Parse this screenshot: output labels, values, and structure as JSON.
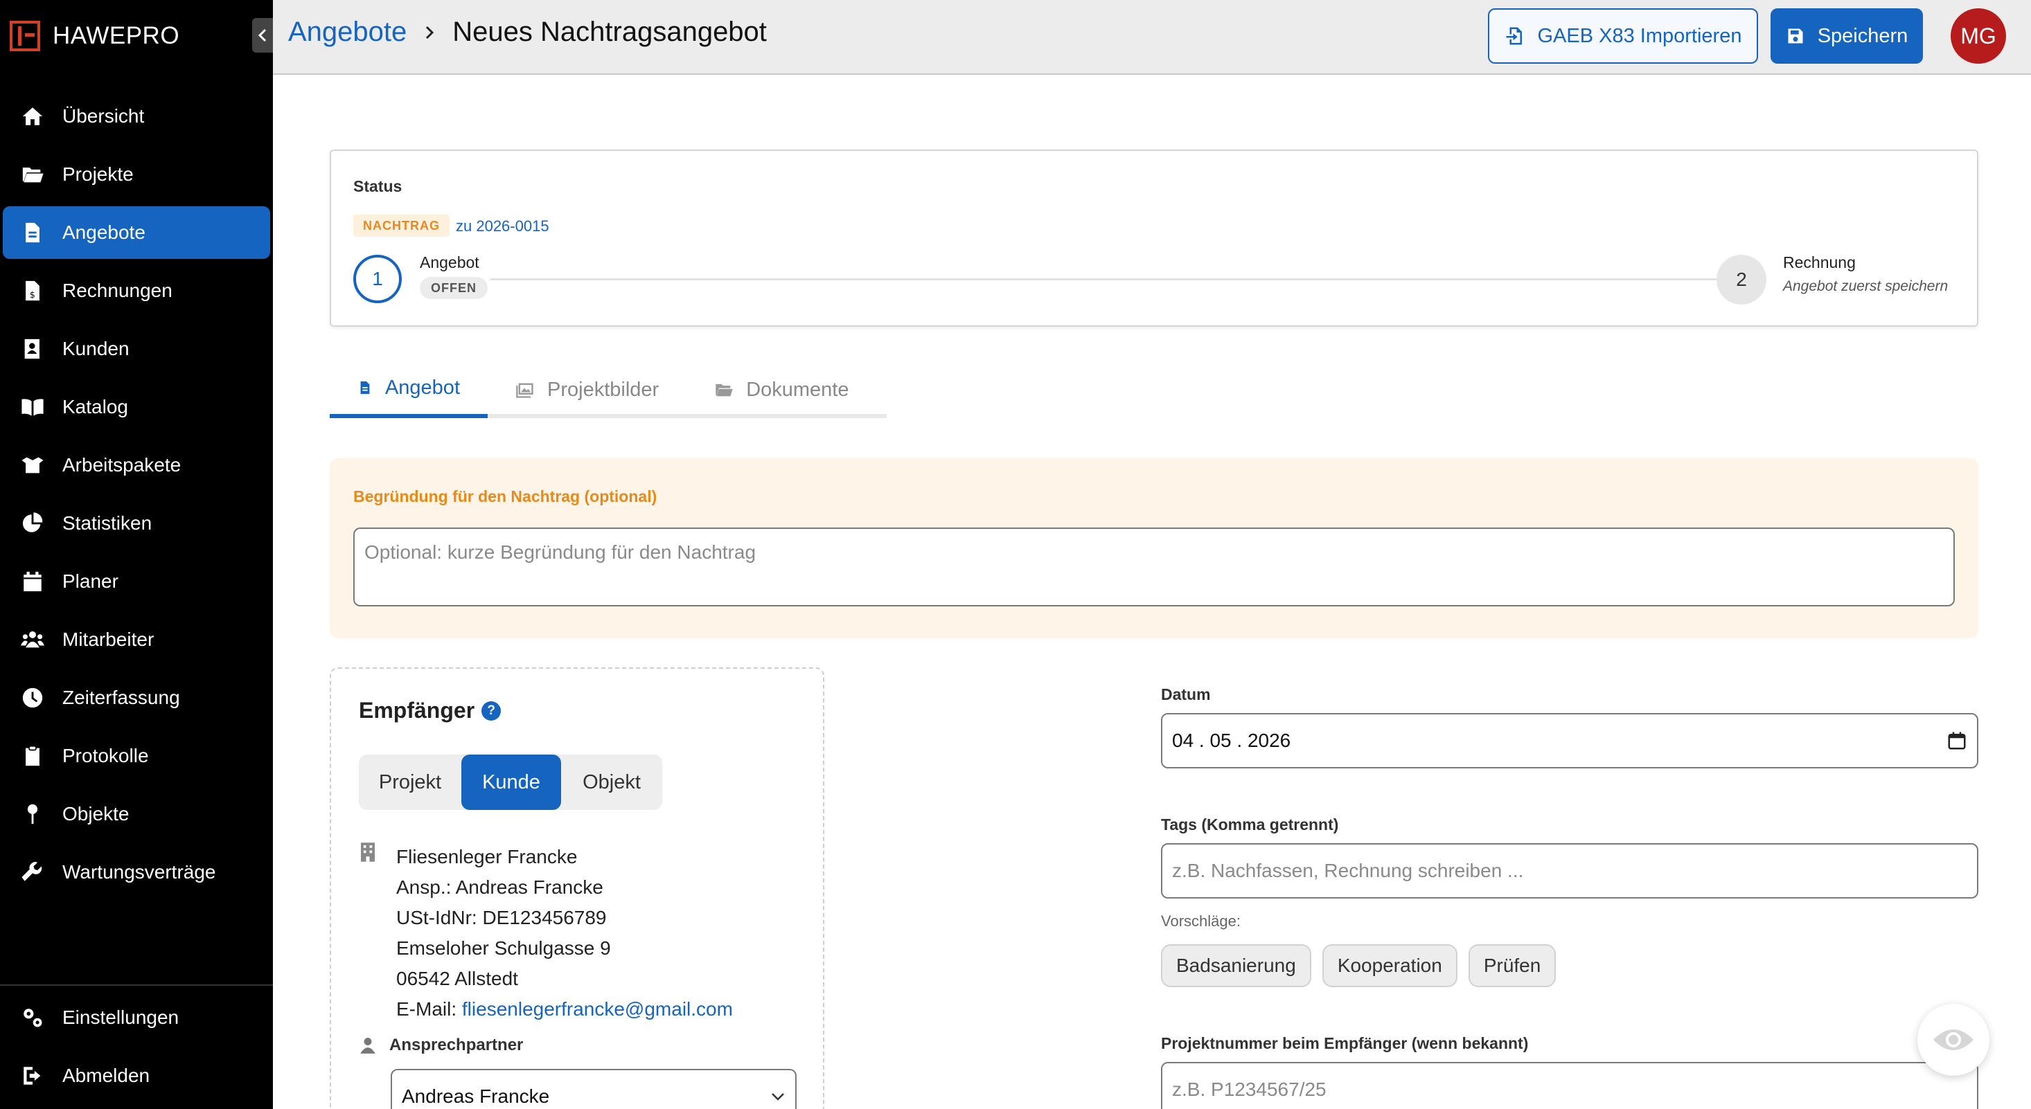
{
  "app": {
    "brand": "HAWEPRO",
    "accent": "#1565c0"
  },
  "sidebar": {
    "items": [
      {
        "label": "Übersicht",
        "icon": "home-icon"
      },
      {
        "label": "Projekte",
        "icon": "folder-open-icon"
      },
      {
        "label": "Angebote",
        "icon": "document-icon",
        "active": true
      },
      {
        "label": "Rechnungen",
        "icon": "invoice-icon"
      },
      {
        "label": "Kunden",
        "icon": "contact-book-icon"
      },
      {
        "label": "Katalog",
        "icon": "book-open-icon"
      },
      {
        "label": "Arbeitspakete",
        "icon": "box-open-icon"
      },
      {
        "label": "Statistiken",
        "icon": "pie-chart-icon"
      },
      {
        "label": "Planer",
        "icon": "calendar-icon"
      },
      {
        "label": "Mitarbeiter",
        "icon": "users-icon"
      },
      {
        "label": "Zeiterfassung",
        "icon": "clock-icon"
      },
      {
        "label": "Protokolle",
        "icon": "clipboard-icon"
      },
      {
        "label": "Objekte",
        "icon": "map-pin-icon"
      },
      {
        "label": "Wartungsverträge",
        "icon": "wrench-icon"
      }
    ],
    "bottom": [
      {
        "label": "Einstellungen",
        "icon": "gears-icon"
      },
      {
        "label": "Abmelden",
        "icon": "logout-icon"
      }
    ]
  },
  "header": {
    "breadcrumb_parent": "Angebote",
    "breadcrumb_current": "Neues Nachtragsangebot",
    "import_label": "GAEB X83 Importieren",
    "save_label": "Speichern",
    "avatar_initials": "MG"
  },
  "status": {
    "title": "Status",
    "badge": "NACHTRAG",
    "reference": "zu 2026-0015",
    "step1": {
      "number": "1",
      "label": "Angebot",
      "badge": "OFFEN"
    },
    "step2": {
      "number": "2",
      "label": "Rechnung",
      "sub": "Angebot zuerst speichern"
    }
  },
  "tabs": [
    {
      "label": "Angebot",
      "icon": "document-icon",
      "active": true
    },
    {
      "label": "Projektbilder",
      "icon": "images-icon"
    },
    {
      "label": "Dokumente",
      "icon": "folder-open-icon"
    }
  ],
  "reason": {
    "label": "Begründung für den Nachtrag (optional)",
    "placeholder": "Optional: kurze Begründung für den Nachtrag",
    "value": ""
  },
  "recipient": {
    "title": "Empfänger",
    "help": "?",
    "segments": [
      "Projekt",
      "Kunde",
      "Objekt"
    ],
    "active_segment": "Kunde",
    "address": {
      "company": "Fliesenleger Francke",
      "contact": "Ansp.: Andreas Francke",
      "vat": "USt-IdNr: DE123456789",
      "street": "Emseloher Schulgasse 9",
      "city": "06542 Allstedt",
      "email_prefix": "E-Mail: ",
      "email": "fliesenlegerfrancke@gmail.com"
    },
    "contact_label": "Ansprechpartner",
    "contact_value": "Andreas Francke"
  },
  "form": {
    "date_label": "Datum",
    "date_value": "04 . 05 . 2026",
    "tags_label": "Tags (Komma getrennt)",
    "tags_placeholder": "z.B. Nachfassen, Rechnung schreiben ...",
    "suggestions_label": "Vorschläge:",
    "suggestions": [
      "Badsanierung",
      "Kooperation",
      "Prüfen"
    ],
    "project_number_label": "Projektnummer beim Empfänger (wenn bekannt)",
    "project_number_placeholder": "z.B. P1234567/25"
  }
}
